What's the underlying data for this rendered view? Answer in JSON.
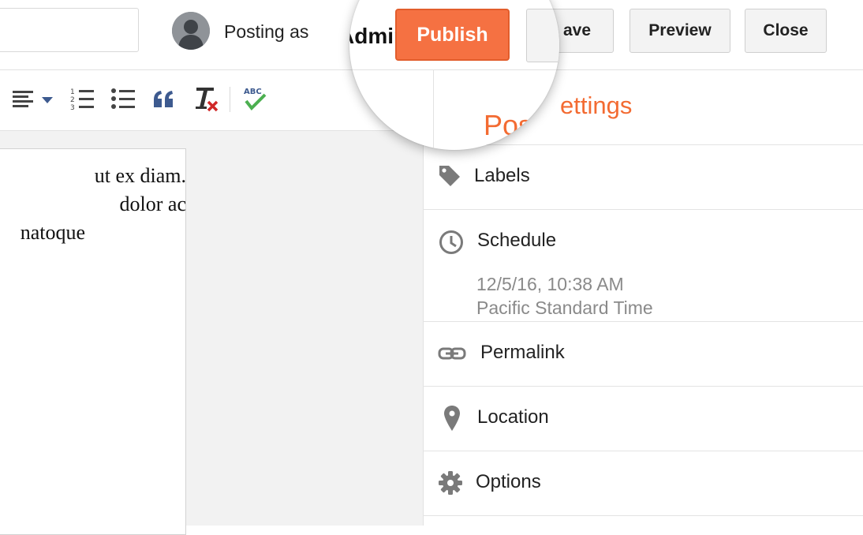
{
  "header": {
    "posting_as_prefix": "Posting as",
    "posting_as_user": "Admin",
    "publish_label": "Publish",
    "save_label": "Save",
    "save_visible_fragment": "ave",
    "preview_label": "Preview",
    "close_label": "Close"
  },
  "toolbar": {
    "icons": [
      "align-icon",
      "numbered-list-icon",
      "bullet-list-icon",
      "quote-icon",
      "remove-formatting-icon",
      "spellcheck-icon"
    ]
  },
  "editor": {
    "lines": [
      "ut ex diam.",
      "dolor ac",
      "natoque"
    ]
  },
  "sidebar": {
    "heading": "Post settings",
    "heading_visible_left": "Pos",
    "heading_visible_right": "ettings",
    "items": [
      {
        "label": "Labels",
        "icon": "tag-icon"
      },
      {
        "label": "Schedule",
        "icon": "clock-icon",
        "value_line1": "12/5/16, 10:38 AM",
        "value_line2": "Pacific Standard Time"
      },
      {
        "label": "Permalink",
        "icon": "link-icon"
      },
      {
        "label": "Location",
        "icon": "pin-icon"
      },
      {
        "label": "Options",
        "icon": "gear-icon"
      }
    ]
  },
  "colors": {
    "accent": "#f36b32",
    "publish_bg": "#f57142",
    "button_bg": "#f3f3f3",
    "icon_blue": "#3d5a8f",
    "editor_bg": "#f2f2f2"
  }
}
